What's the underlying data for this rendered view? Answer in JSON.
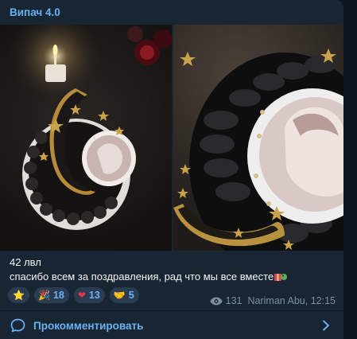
{
  "post": {
    "channel_name": "Випач 4.0",
    "text_line1": "42 лвл",
    "text_line2": "спасибо всем за поздравления, рад что мы все вместе",
    "views": "131",
    "author_time": "Nariman Abu, 12:15"
  },
  "reactions": [
    {
      "emoji": "⭐",
      "count": ""
    },
    {
      "emoji": "🎉",
      "count": "18"
    },
    {
      "emoji": "❤",
      "count": "13"
    },
    {
      "emoji": "🤝",
      "count": "5"
    }
  ],
  "comments": {
    "label": "Прокомментировать"
  },
  "colors": {
    "accent": "#6ab3f3",
    "bubble_bg": "#182533",
    "app_bg": "#0e1621",
    "meta_text": "#7d8e9f"
  }
}
